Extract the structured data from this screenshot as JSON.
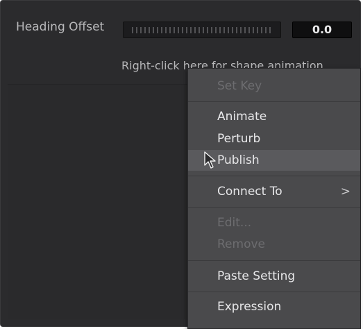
{
  "heading": {
    "label": "Heading Offset",
    "value": "0.0"
  },
  "hint": "Right-click here for shape animation",
  "menu": {
    "items": [
      {
        "label": "Set Key",
        "enabled": false
      },
      {
        "label": "Animate",
        "enabled": true
      },
      {
        "label": "Perturb",
        "enabled": true
      },
      {
        "label": "Publish",
        "enabled": true,
        "hovered": true
      },
      {
        "label": "Connect To",
        "enabled": true,
        "submenu": true
      },
      {
        "label": "Edit...",
        "enabled": false
      },
      {
        "label": "Remove",
        "enabled": false
      },
      {
        "label": "Paste Setting",
        "enabled": true
      },
      {
        "label": "Expression",
        "enabled": true
      }
    ],
    "submenu_indicator": ">"
  },
  "colors": {
    "panel_bg": "#2b2b2d",
    "menu_bg": "#4a4a4c",
    "menu_text": "#e7e7e9",
    "disabled_text": "#6d6d70"
  }
}
